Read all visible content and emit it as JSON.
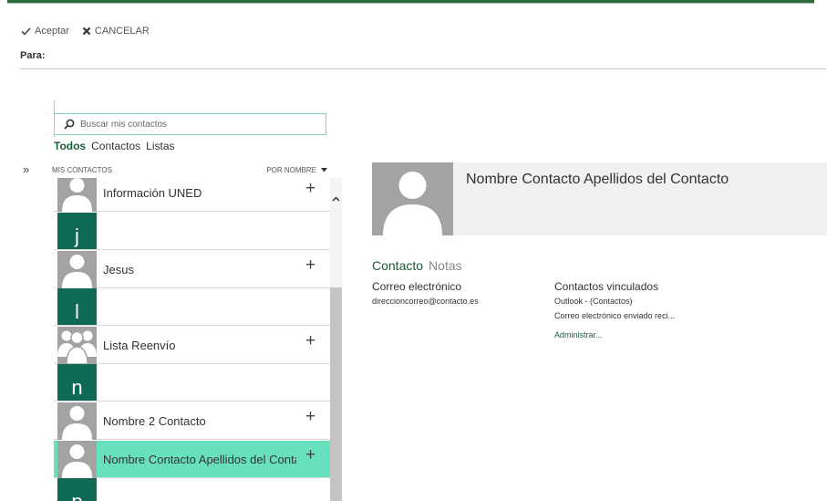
{
  "toolbar": {
    "accept": "Aceptar",
    "cancel": "CANCELAR"
  },
  "to_label": "Para:",
  "expand_glyph": "»",
  "search": {
    "placeholder": "Buscar mis contactos"
  },
  "filters": [
    "Todos",
    "Contactos",
    "Listas"
  ],
  "list_header": {
    "left": "MIS CONTACTOS",
    "sort": "POR NOMBRE"
  },
  "contacts": [
    {
      "name": "Información UNED"
    },
    {
      "letter": "j"
    },
    {
      "name": "Jesus"
    },
    {
      "letter": "l"
    },
    {
      "name": "Lista Reenvío"
    },
    {
      "letter": "n"
    },
    {
      "name": "Nombre 2 Contacto"
    },
    {
      "name": "Nombre Contacto Apellidos del Contacto"
    },
    {
      "letter": "p"
    }
  ],
  "detail": {
    "name": "Nombre Contacto Apellidos del Contacto",
    "tabs": [
      "Contacto",
      "Notas"
    ],
    "email_title": "Correo electrónico",
    "email_value": "direccioncorreo@contacto.es",
    "linked_title": "Contactos vinculados",
    "linked_lines": [
      "Outlook - (Contactos)",
      "Correo electrónico enviado reci..."
    ],
    "admin_link": "Administrar..."
  },
  "colors": {
    "accent": "#1d5b3a",
    "selected_row": "#68e0be",
    "letter_block": "#0e6a54",
    "avatar_gray": "#a3a3a3"
  },
  "icons": {
    "accept": "check-icon",
    "cancel": "x-icon",
    "search": "search-icon",
    "sort": "caret-down-icon",
    "add": "plus-icon",
    "scroll_up": "chevron-up-icon"
  }
}
